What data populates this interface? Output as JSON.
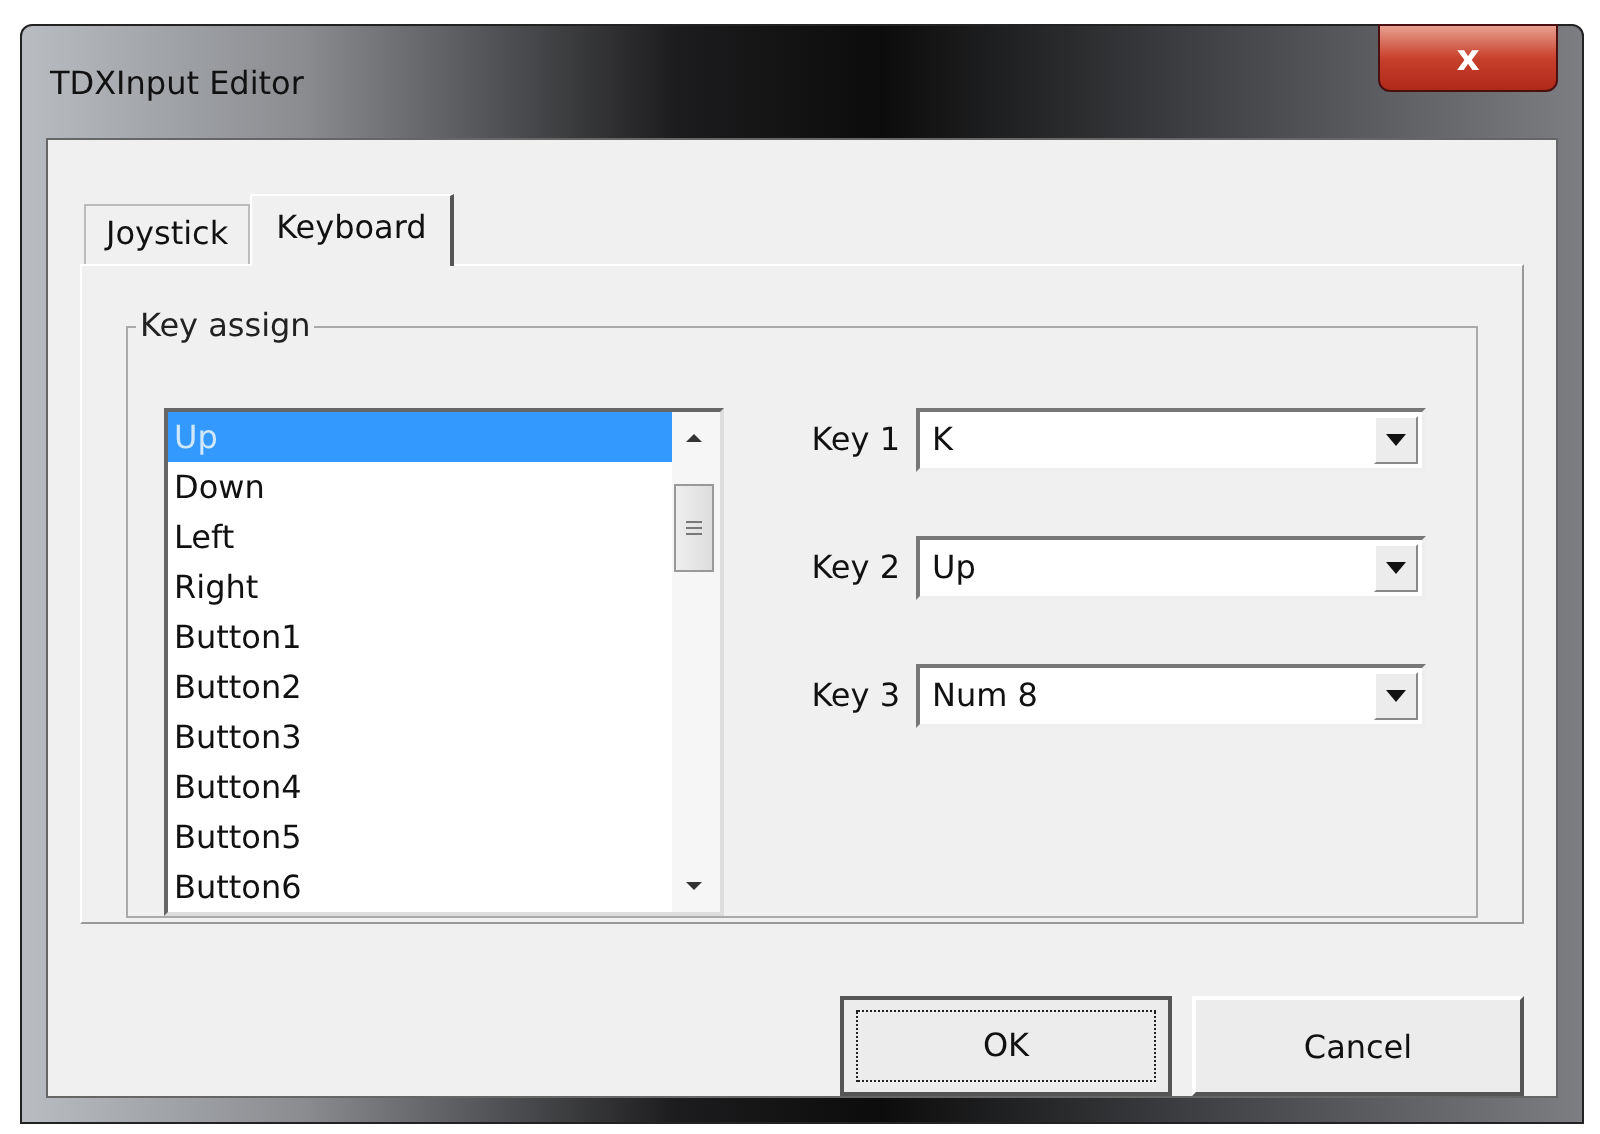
{
  "window": {
    "title": "TDXInput Editor",
    "close": "x"
  },
  "tabs": [
    {
      "label": "Joystick",
      "selected": false
    },
    {
      "label": "Keyboard",
      "selected": true
    }
  ],
  "group": {
    "title": "Key assign"
  },
  "list": {
    "items": [
      {
        "label": "Up",
        "selected": true
      },
      {
        "label": "Down",
        "selected": false
      },
      {
        "label": "Left",
        "selected": false
      },
      {
        "label": "Right",
        "selected": false
      },
      {
        "label": "Button1",
        "selected": false
      },
      {
        "label": "Button2",
        "selected": false
      },
      {
        "label": "Button3",
        "selected": false
      },
      {
        "label": "Button4",
        "selected": false
      },
      {
        "label": "Button5",
        "selected": false
      },
      {
        "label": "Button6",
        "selected": false
      }
    ]
  },
  "keys": [
    {
      "label": "Key 1",
      "value": "K"
    },
    {
      "label": "Key 2",
      "value": "Up"
    },
    {
      "label": "Key 3",
      "value": "Num 8"
    }
  ],
  "buttons": [
    {
      "label": "OK",
      "focused": true
    },
    {
      "label": "Cancel",
      "focused": false
    }
  ]
}
